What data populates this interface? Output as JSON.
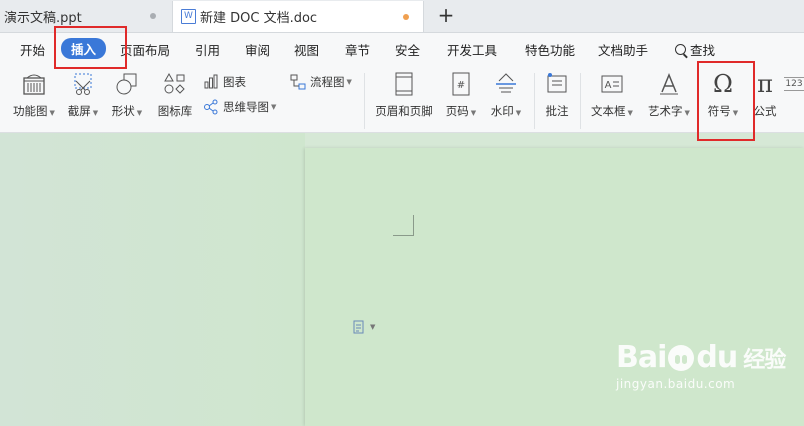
{
  "tabs": {
    "inactive": {
      "title": "演示文稿.ppt"
    },
    "active": {
      "title": "新建 DOC 文档.doc",
      "icon": "W"
    },
    "new_tab": "+"
  },
  "menu": {
    "tabs": [
      "开始",
      "插入",
      "页面布局",
      "引用",
      "审阅",
      "视图",
      "章节",
      "安全",
      "开发工具",
      "特色功能",
      "文档助手"
    ],
    "search": "查找",
    "active_index": 1,
    "accent_color": "#3a78d8"
  },
  "toolbar": {
    "function_chart": "功能图",
    "screenshot": "截屏",
    "shapes": "形状",
    "icon_library": "图标库",
    "chart": "图表",
    "mind_map": "思维导图",
    "flowchart": "流程图",
    "header_footer": "页眉和页脚",
    "page_number": "页码",
    "watermark": "水印",
    "comment": "批注",
    "textbox": "文本框",
    "wordart": "艺术字",
    "symbol": "符号",
    "formula": "公式",
    "symbol_glyph": "Ω",
    "formula_glyph": "π",
    "number_glyph": "123"
  },
  "highlight_color": "#e02a2a",
  "watermark": {
    "brand": "Bai",
    "brand2": "du",
    "cn": "经验",
    "url": "jingyan.baidu.com"
  }
}
